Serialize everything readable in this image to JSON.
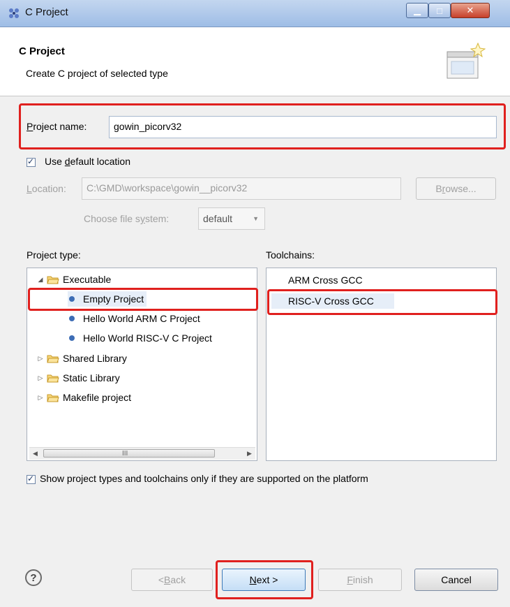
{
  "window": {
    "title": "C Project"
  },
  "header": {
    "title": "C Project",
    "subtitle": "Create C project of selected type"
  },
  "project_name": {
    "label_pre": "",
    "label_u": "P",
    "label_post": "roject name:",
    "value": "gowin_picorv32"
  },
  "default_location": {
    "checked": true,
    "label_pre": "Use ",
    "label_u": "d",
    "label_post": "efault location"
  },
  "location": {
    "label_u": "L",
    "label_post": "ocation:",
    "value": "C:\\GMD\\workspace\\gowin__picorv32",
    "browse_pre": "B",
    "browse_u": "r",
    "browse_post": "owse..."
  },
  "file_system": {
    "label_pre": "Choose file s",
    "label_u": "y",
    "label_post": "stem:",
    "value": "default"
  },
  "project_type": {
    "label": "Project type:",
    "items": [
      {
        "label": "Executable",
        "kind": "folder-open"
      },
      {
        "label": "Empty Project",
        "kind": "leaf"
      },
      {
        "label": "Hello World ARM C Project",
        "kind": "leaf"
      },
      {
        "label": "Hello World RISC-V C Project",
        "kind": "leaf"
      },
      {
        "label": "Shared Library",
        "kind": "folder"
      },
      {
        "label": "Static Library",
        "kind": "folder"
      },
      {
        "label": "Makefile project",
        "kind": "folder"
      }
    ],
    "selected": "Empty Project"
  },
  "toolchains": {
    "label": "Toolchains:",
    "items": [
      "ARM Cross GCC",
      "RISC-V Cross GCC"
    ],
    "selected": "RISC-V Cross GCC"
  },
  "show_supported": {
    "checked": true,
    "label": "Show project types and toolchains only if they are supported on the platform"
  },
  "buttons": {
    "back_pre": "< ",
    "back_u": "B",
    "back_post": "ack",
    "next_u": "N",
    "next_post": "ext >",
    "finish_u": "F",
    "finish_post": "inish",
    "cancel": "Cancel"
  },
  "icons": {
    "help": "?",
    "scroll_grip": "III"
  },
  "colors": {
    "highlight": "#e0201e",
    "selection": "#e6eef8"
  }
}
